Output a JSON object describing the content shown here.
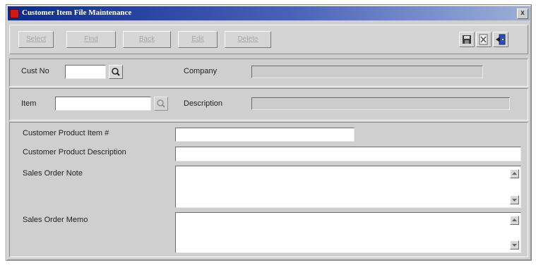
{
  "window": {
    "title": "Customer Item File Maintenance",
    "close_label": "x"
  },
  "toolbar": {
    "select_label": "Select",
    "find_label": "Find",
    "back_label": "Back",
    "edit_label": "Edit",
    "delete_label": "Delete",
    "icons": [
      "save-icon",
      "cancel-icon",
      "exit-icon"
    ]
  },
  "header": {
    "cust_no_label": "Cust No",
    "cust_no_value": "",
    "company_label": "Company",
    "company_value": ""
  },
  "item_row": {
    "item_label": "Item",
    "item_value": "",
    "description_label": "Description",
    "description_value": ""
  },
  "details": {
    "product_item_label": "Customer Product Item #",
    "product_item_value": "",
    "product_desc_label": "Customer Product Description",
    "product_desc_value": "",
    "sales_order_note_label": "Sales Order Note",
    "sales_order_memo_label": "Sales Order Memo"
  }
}
